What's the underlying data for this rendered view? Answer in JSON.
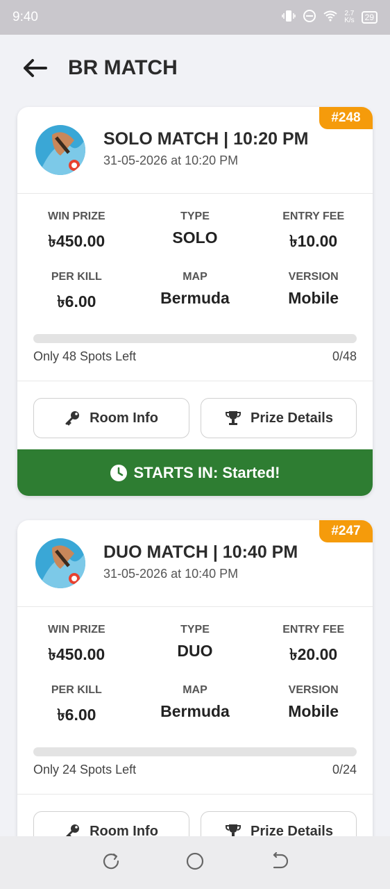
{
  "status_bar": {
    "time": "9:40",
    "net_speed_top": "2.7",
    "net_speed_bottom": "K/s",
    "battery": "29"
  },
  "header": {
    "title": "BR MATCH"
  },
  "matches": [
    {
      "id": "#248",
      "title": "SOLO MATCH | 10:20 PM",
      "date": "31-05-2026 at 10:20 PM",
      "stats": {
        "win_prize_label": "WIN PRIZE",
        "win_prize": "৳450.00",
        "type_label": "TYPE",
        "type": "SOLO",
        "entry_fee_label": "ENTRY FEE",
        "entry_fee": "৳10.00",
        "per_kill_label": "PER KILL",
        "per_kill": "৳6.00",
        "map_label": "MAP",
        "map": "Bermuda",
        "version_label": "VERSION",
        "version": "Mobile"
      },
      "spots_left": "Only 48 Spots Left",
      "spots_count": "0/48",
      "progress_fraction": 0,
      "room_info_label": "Room Info",
      "prize_details_label": "Prize Details",
      "start_status": "STARTS IN: Started!"
    },
    {
      "id": "#247",
      "title": "DUO MATCH | 10:40 PM",
      "date": "31-05-2026 at 10:40 PM",
      "stats": {
        "win_prize_label": "WIN PRIZE",
        "win_prize": "৳450.00",
        "type_label": "TYPE",
        "type": "DUO",
        "entry_fee_label": "ENTRY FEE",
        "entry_fee": "৳20.00",
        "per_kill_label": "PER KILL",
        "per_kill": "৳6.00",
        "map_label": "MAP",
        "map": "Bermuda",
        "version_label": "VERSION",
        "version": "Mobile"
      },
      "spots_left": "Only 24 Spots Left",
      "spots_count": "0/24",
      "progress_fraction": 0,
      "room_info_label": "Room Info",
      "prize_details_label": "Prize Details"
    }
  ],
  "colors": {
    "accent_orange": "#f59b0b",
    "accent_green": "#2e7d32"
  },
  "icons": [
    "back-arrow-icon",
    "key-icon",
    "trophy-icon",
    "clock-icon",
    "recent-apps-icon",
    "home-icon",
    "back-nav-icon"
  ]
}
